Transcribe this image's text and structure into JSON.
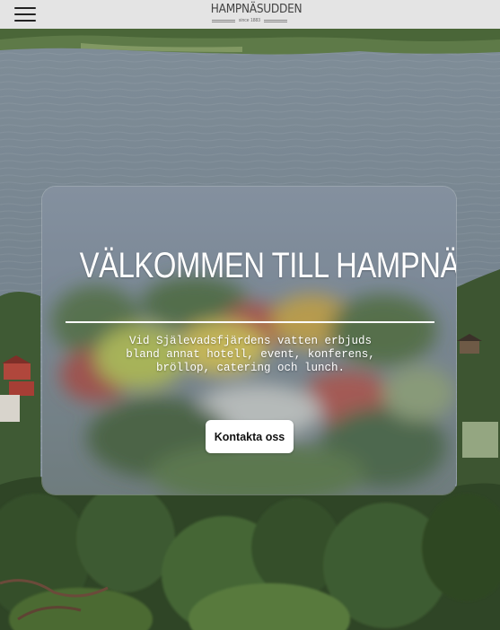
{
  "header": {
    "logo_name": "HAMPNÄSUDDEN",
    "logo_since": "since 1883",
    "menu_icon": "hamburger-menu-icon"
  },
  "hero": {
    "title": "VÄLKOMMEN TILL HAMPNÄSUDDEN",
    "description": "Vid Själevadsfjärdens vatten erbjuds bland annat hotell, event, konferens, bröllop, catering och lunch.",
    "cta_label": "Kontakta oss"
  },
  "colors": {
    "header_bg": "#e4e4e4",
    "card_text": "#ffffff",
    "button_bg": "#ffffff",
    "button_text": "#111111"
  }
}
